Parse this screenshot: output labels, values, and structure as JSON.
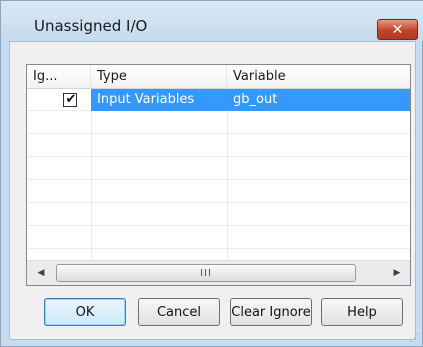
{
  "window": {
    "title": "Unassigned I/O",
    "close_icon": "close-icon",
    "close_glyph": "✕"
  },
  "list": {
    "columns": [
      "Ig...",
      "Type",
      "Variable"
    ],
    "rows": [
      {
        "ignored": true,
        "check_glyph": "✔",
        "type": "Input Variables",
        "variable": "gb_out",
        "selected": true
      }
    ]
  },
  "hscroll": {
    "left_glyph": "◀",
    "right_glyph": "▶",
    "grip_glyph": "III"
  },
  "buttons": {
    "ok": "OK",
    "cancel": "Cancel",
    "clear_ignore": "Clear Ignore",
    "help": "Help"
  },
  "colors": {
    "selection": "#3399ff",
    "close_button": "#c0432a",
    "title_bar": "#c6dbee"
  }
}
